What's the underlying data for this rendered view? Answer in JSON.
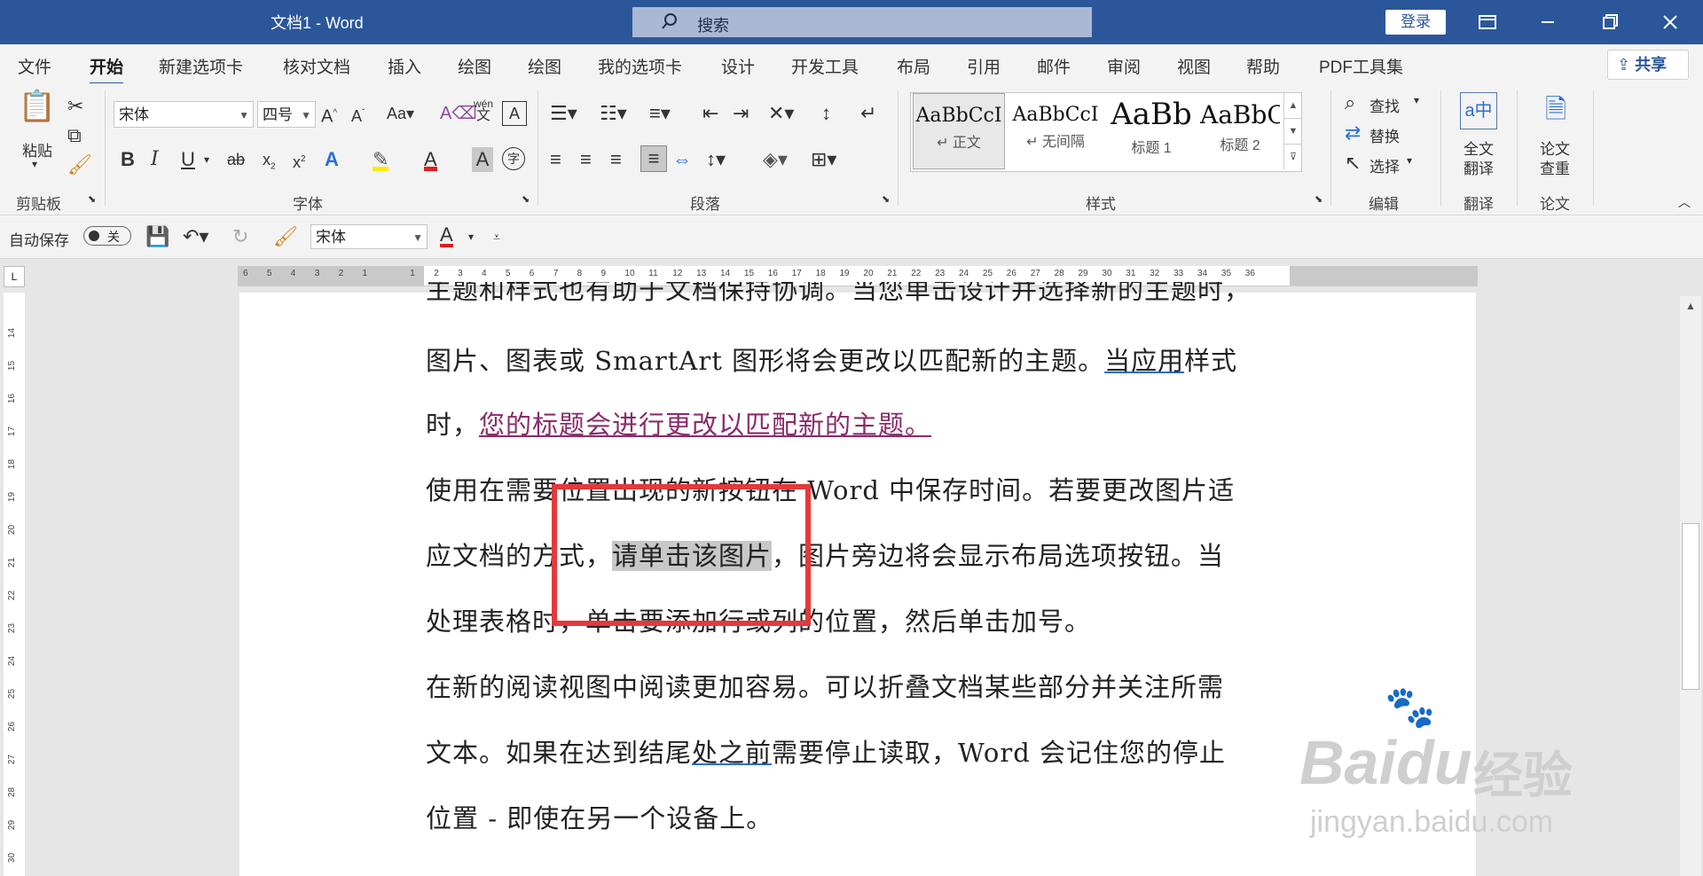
{
  "window": {
    "title": "文档1  -  Word",
    "search_placeholder": "搜索",
    "login": "登录"
  },
  "tabs": [
    "文件",
    "开始",
    "新建选项卡",
    "核对文档",
    "插入",
    "绘图",
    "绘图",
    "我的选项卡",
    "设计",
    "开发工具",
    "布局",
    "引用",
    "邮件",
    "审阅",
    "视图",
    "帮助",
    "PDF工具集"
  ],
  "share": "共享",
  "ribbon": {
    "clipboard": {
      "paste": "粘贴",
      "group": "剪贴板"
    },
    "font": {
      "name": "宋体",
      "size": "四号",
      "group": "字体"
    },
    "paragraph": {
      "group": "段落"
    },
    "styles": {
      "items": [
        {
          "preview": "AaBbCcI",
          "name": "↵ 正文"
        },
        {
          "preview": "AaBbCcI",
          "name": "↵ 无间隔"
        },
        {
          "preview": "AaBb",
          "name": "标题 1"
        },
        {
          "preview": "AaBbC",
          "name": "标题 2"
        }
      ],
      "group": "样式"
    },
    "editing": {
      "find": "查找",
      "replace": "替换",
      "select": "选择",
      "group": "编辑"
    },
    "translate": {
      "full": "全文",
      "full2": "翻译",
      "group": "翻译"
    },
    "paper": {
      "check": "论文",
      "check2": "查重",
      "group": "论文"
    }
  },
  "qat": {
    "autosave": "自动保存",
    "toggle": "关",
    "font": "宋体"
  },
  "ruler": {
    "h_ticks": [
      "6",
      "5",
      "4",
      "3",
      "2",
      "1",
      "",
      "1",
      "2",
      "3",
      "4",
      "5",
      "6",
      "7",
      "8",
      "9",
      "10",
      "11",
      "12",
      "13",
      "14",
      "15",
      "16",
      "17",
      "18",
      "19",
      "20",
      "21",
      "22",
      "23",
      "24",
      "25",
      "26",
      "27",
      "28",
      "29",
      "30",
      "31",
      "32",
      "33",
      "34",
      "35",
      "36"
    ],
    "v_ticks": [
      "14",
      "15",
      "16",
      "17",
      "18",
      "19",
      "20",
      "21",
      "22",
      "23",
      "24",
      "25",
      "26",
      "27",
      "28",
      "29",
      "30"
    ]
  },
  "document": {
    "line0": "主题和样式也有助于文档保持协调。当您单击设计并选择新的主题时，",
    "line1a": "图片、图表或 SmartArt 图形将会更改以匹配新的主题。",
    "line1b": "当应用",
    "line1c": "样式",
    "line2a": "时，",
    "line2b": "您的标题会进行更改以匹配新的主题。",
    "line3": "使用在需要位置出现的新按钮在 Word 中保存时间。若要更改图片适",
    "line4a": "应文档的方式，",
    "line4b": "请单击该图片",
    "line4c": "，图片旁边将会显示布局选项按钮。当",
    "line5": "处理表格时，单击要添加行或列的位置，然后单击加号。",
    "line6": "在新的阅读视图中阅读更加容易。可以折叠文档某些部分并关注所需",
    "line7a": "文本。如果在达到结尾",
    "line7b": "处之前",
    "line7c": "需要停止读取，Word 会记住您的停止",
    "line8": "位置 - 即使在另一个设备上。"
  },
  "watermark": {
    "brand": "Bai",
    "brand2": "du",
    "cn": "经验",
    "url": "jingyan.baidu.com"
  }
}
